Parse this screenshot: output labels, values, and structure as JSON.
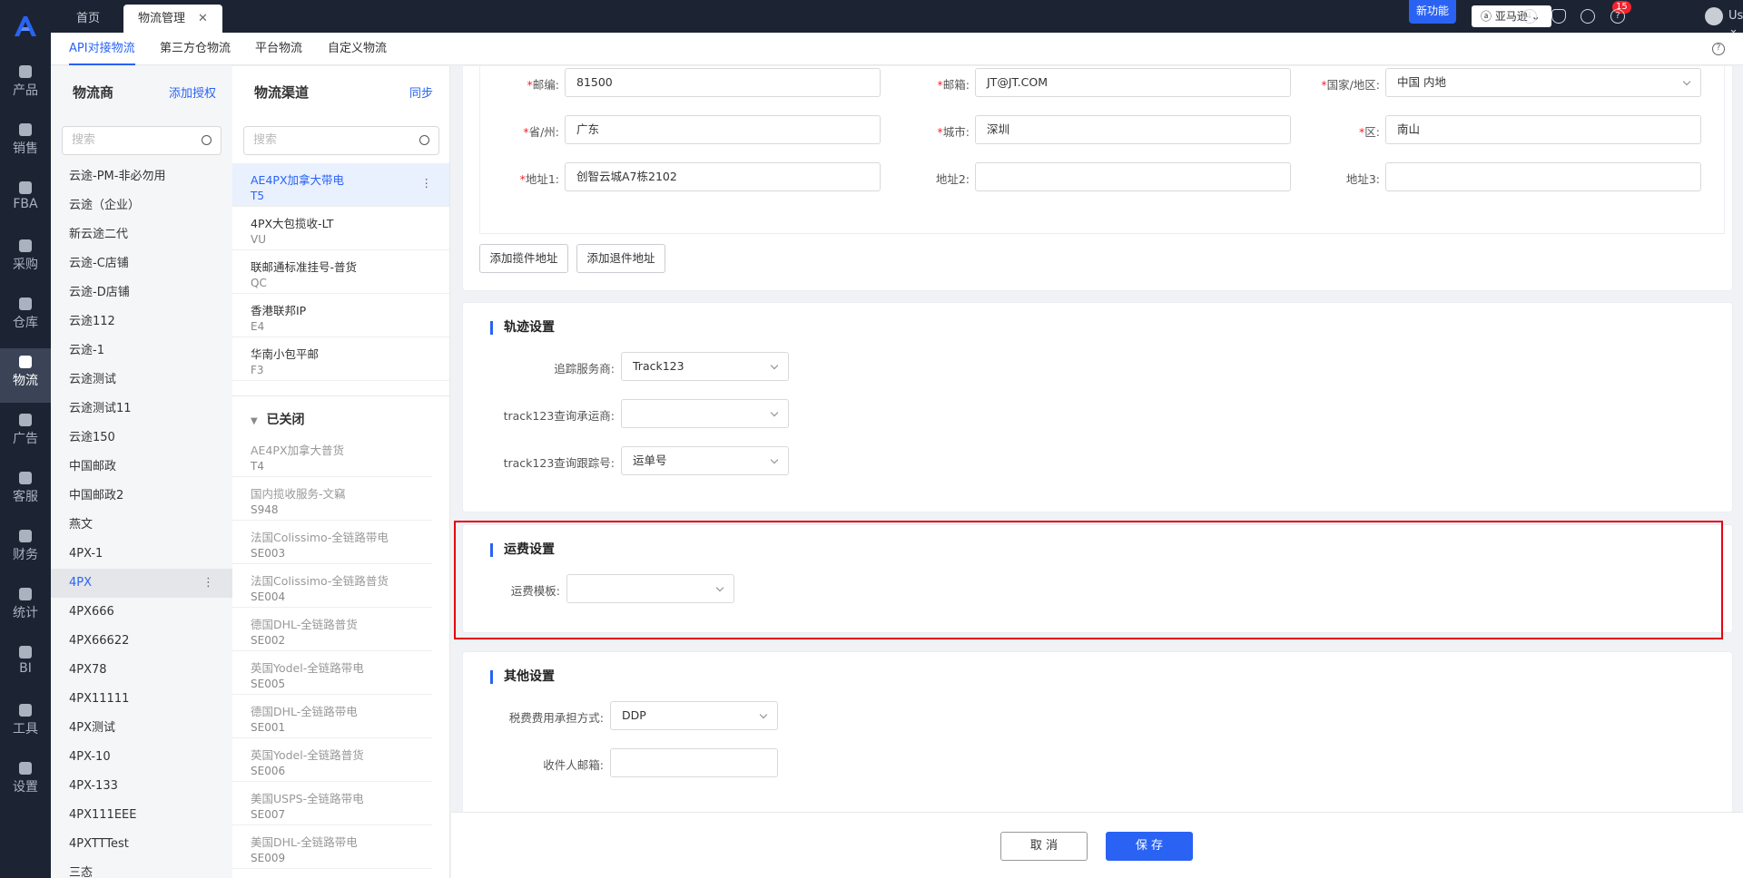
{
  "nav": {
    "items": [
      {
        "label": "产品",
        "icon": "box-icon"
      },
      {
        "label": "销售",
        "icon": "tag-icon"
      },
      {
        "label": "FBA",
        "icon": "warehouse-icon"
      },
      {
        "label": "采购",
        "icon": "cart-icon"
      },
      {
        "label": "仓库",
        "icon": "building-icon"
      },
      {
        "label": "物流",
        "icon": "truck-icon"
      },
      {
        "label": "广告",
        "icon": "ad-icon"
      },
      {
        "label": "客服",
        "icon": "mail-icon"
      },
      {
        "label": "财务",
        "icon": "money-icon"
      },
      {
        "label": "统计",
        "icon": "pie-icon"
      },
      {
        "label": "BI",
        "icon": "chart-icon"
      },
      {
        "label": "工具",
        "icon": "wrench-icon"
      },
      {
        "label": "设置",
        "icon": "gear-icon"
      }
    ],
    "active": "物流"
  },
  "topbar": {
    "tabs": [
      {
        "label": "首页"
      },
      {
        "label": "物流管理"
      }
    ],
    "new_feature": "新功能",
    "store": "亚马逊",
    "notif_count": "15",
    "user": "User"
  },
  "subtabs": [
    "API对接物流",
    "第三方仓物流",
    "平台物流",
    "自定义物流"
  ],
  "carriers": {
    "title": "物流商",
    "action": "添加授权",
    "search_placeholder": "搜索",
    "items": [
      "云途-PM-非必勿用",
      "云途（企业）",
      "新云途二代",
      "云途-C店铺",
      "云途-D店铺",
      "云途112",
      "云途-1",
      "云途测试",
      "云途测试11",
      "云途150",
      "中国邮政",
      "中国邮政2",
      "燕文",
      "4PX-1",
      "4PX",
      "4PX666",
      "4PX66622",
      "4PX78",
      "4PX11111",
      "4PX测试",
      "4PX-10",
      "4PX-133",
      "4PX111EEE",
      "4PXTTTest",
      "三态"
    ],
    "selected": "4PX"
  },
  "channels": {
    "title": "物流渠道",
    "action": "同步",
    "search_placeholder": "搜索",
    "open": [
      {
        "name": "AE4PX加拿大带电",
        "code": "T5"
      },
      {
        "name": "4PX大包揽收-LT",
        "code": "VU"
      },
      {
        "name": "联邮通标准挂号-普货",
        "code": "QC"
      },
      {
        "name": "香港联邦IP",
        "code": "E4"
      },
      {
        "name": "华南小包平邮",
        "code": "F3"
      }
    ],
    "closed_title": "已关闭",
    "closed": [
      {
        "name": "AE4PX加拿大普货",
        "code": "T4"
      },
      {
        "name": "国内揽收服务-文竊",
        "code": "S948"
      },
      {
        "name": "法国Colissimo-全链路带电",
        "code": "SE003"
      },
      {
        "name": "法国Colissimo-全链路普货",
        "code": "SE004"
      },
      {
        "name": "德国DHL-全链路普货",
        "code": "SE002"
      },
      {
        "name": "英国Yodel-全链路带电",
        "code": "SE005"
      },
      {
        "name": "德国DHL-全链路带电",
        "code": "SE001"
      },
      {
        "name": "英国Yodel-全链路普货",
        "code": "SE006"
      },
      {
        "name": "美国USPS-全链路带电",
        "code": "SE007"
      },
      {
        "name": "美国DHL-全链路带电",
        "code": "SE009"
      }
    ]
  },
  "address": {
    "fields": [
      {
        "label": "邮编:",
        "value": "81500",
        "required": true
      },
      {
        "label": "邮箱:",
        "value": "JT@JT.COM",
        "required": true
      },
      {
        "label": "国家/地区:",
        "value": "中国 内地",
        "required": true
      },
      {
        "label": "省/州:",
        "value": "广东",
        "required": true
      },
      {
        "label": "城市:",
        "value": "深圳",
        "required": true
      },
      {
        "label": "区:",
        "value": "南山",
        "required": true
      },
      {
        "label": "地址1:",
        "value": "创智云城A7栋2102",
        "required": true
      },
      {
        "label": "地址2:",
        "value": "",
        "required": false
      },
      {
        "label": "地址3:",
        "value": "",
        "required": false
      }
    ],
    "add_pickup": "添加揽件地址",
    "add_return": "添加退件地址"
  },
  "tracking": {
    "title": "轨迹设置",
    "provider_label": "追踪服务商:",
    "provider_value": "Track123",
    "carrier_label": "track123查询承运商:",
    "carrier_value": "",
    "number_label": "track123查询跟踪号:",
    "number_value": "运单号"
  },
  "freight": {
    "title": "运费设置",
    "template_label": "运费模板:",
    "template_value": ""
  },
  "other": {
    "title": "其他设置",
    "tax_label": "税费费用承担方式:",
    "tax_value": "DDP",
    "email_label": "收件人邮箱:",
    "email_value": ""
  },
  "footer": {
    "cancel": "取 消",
    "save": "保 存"
  },
  "colors": {
    "accent": "#2a63f4",
    "nav_bg": "#1c2433",
    "highlight": "#e60012",
    "badge": "#f5222d"
  }
}
